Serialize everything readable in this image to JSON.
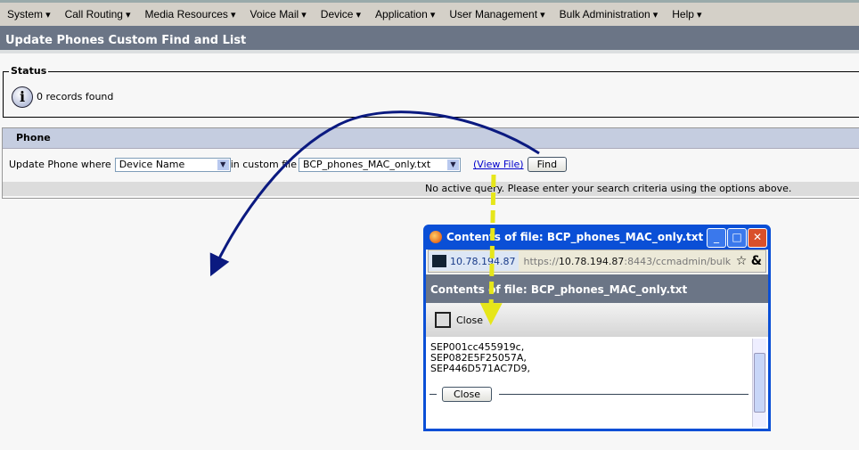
{
  "menu": [
    "System",
    "Call Routing",
    "Media Resources",
    "Voice Mail",
    "Device",
    "Application",
    "User Management",
    "Bulk Administration",
    "Help"
  ],
  "page_title": "Update Phones Custom Find and List",
  "status": {
    "legend": "Status",
    "message": "0 records found",
    "icon": "info-icon"
  },
  "phone": {
    "header": "Phone",
    "prefix": "Update Phone where",
    "field_select": "Device Name",
    "middle": "in custom file",
    "file_select": "BCP_phones_MAC_only.txt",
    "view_file": "(View File)",
    "find": "Find",
    "hint": "No active query. Please enter your search criteria using the options above."
  },
  "popup": {
    "window_title": "Contents of file: BCP_phones_MAC_only.txt ...",
    "site": "10.78.194.87",
    "url_pre": "https://",
    "url_host": "10.78.194.87",
    "url_rest": ":8443/ccmadmin/bulk",
    "header": "Contents of file: BCP_phones_MAC_only.txt",
    "toolbar_close": "Close",
    "lines": [
      "SEP001cc455919c,",
      "SEP082E5F25057A,",
      "SEP446D571AC7D9,"
    ],
    "close_button": "Close"
  },
  "annotations": {
    "arrow_color": "#0b1a80",
    "dashed_arrow_color": "#e6e61a"
  }
}
